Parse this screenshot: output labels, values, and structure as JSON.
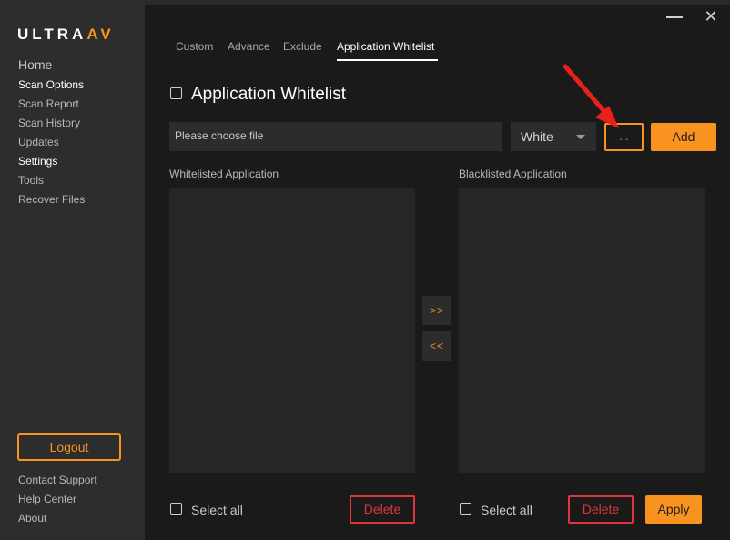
{
  "app": {
    "logo_main": "ULTRA",
    "logo_accent": "AV"
  },
  "sidebar": {
    "items": [
      {
        "label": "Home"
      },
      {
        "label": "Scan Options"
      },
      {
        "label": "Scan Report"
      },
      {
        "label": "Scan History"
      },
      {
        "label": "Updates"
      },
      {
        "label": "Settings"
      },
      {
        "label": "Tools"
      },
      {
        "label": "Recover Files"
      }
    ],
    "logout_label": "Logout",
    "footer": [
      {
        "label": "Contact Support"
      },
      {
        "label": "Help Center"
      },
      {
        "label": "About"
      }
    ]
  },
  "window": {
    "minimize_icon": "minimize-icon",
    "close_glyph": "✕"
  },
  "tabs": [
    {
      "label": "Custom"
    },
    {
      "label": "Advance"
    },
    {
      "label": "Exclude"
    },
    {
      "label": "Application Whitelist",
      "active": true
    }
  ],
  "main": {
    "section_title": "Application Whitelist",
    "file_placeholder": "Please choose file",
    "list_type_selected": "White",
    "browse_label": "...",
    "add_label": "Add",
    "whitelist_label": "Whitelisted Application",
    "blacklist_label": "Blacklisted Application",
    "move_right_label": ">>",
    "move_left_label": "<<",
    "select_all_label": "Select all",
    "delete_label": "Delete",
    "apply_label": "Apply"
  },
  "colors": {
    "accent": "#f7931e",
    "danger": "#e0353f",
    "sidebar_bg": "#2d2d2d",
    "content_bg": "#1a1a1a",
    "annotation_arrow": "#e8201a"
  }
}
